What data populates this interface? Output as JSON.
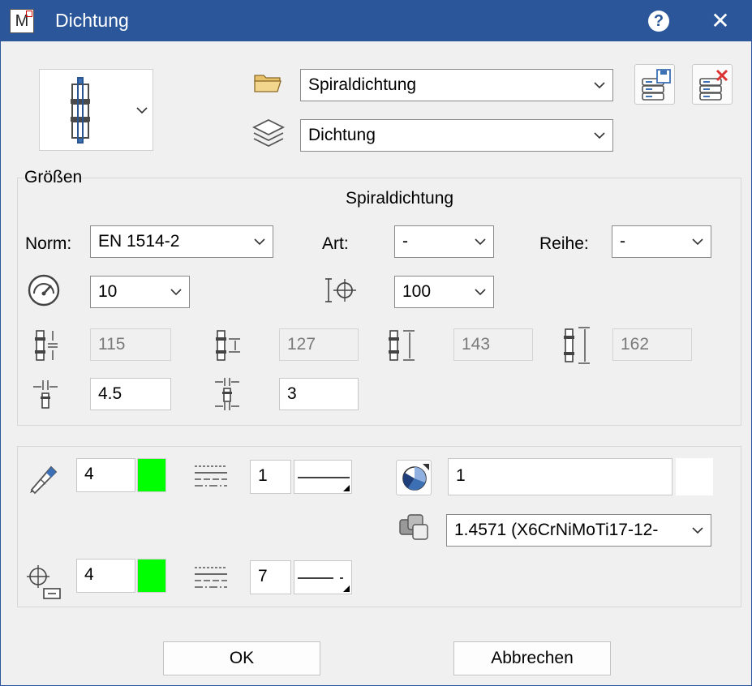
{
  "window": {
    "title": "Dichtung",
    "app_icon_letter": "M",
    "help_label": "?",
    "close_label": "✕"
  },
  "top": {
    "catalog_select": "Spiraldichtung",
    "layer_select": "Dichtung"
  },
  "sizes": {
    "group_title": "Größen",
    "heading": "Spiraldichtung",
    "norm_label": "Norm:",
    "norm_value": "EN 1514-2",
    "art_label": "Art:",
    "art_value": "-",
    "reihe_label": "Reihe:",
    "reihe_value": "-",
    "pressure_value": "10",
    "nominal_value": "100",
    "dim1": "115",
    "dim2": "127",
    "dim3": "143",
    "dim4": "162",
    "thickness1": "4.5",
    "thickness2": "3"
  },
  "attributes": {
    "pen_value": "4",
    "pen_color": "#00ff00",
    "line_style_value": "1",
    "fill_value": "1",
    "material_value": "1.4571 (X6CrNiMoTi17-12-",
    "axis_pen_value": "4",
    "axis_pen_color": "#00ff00",
    "axis_line_style_value": "7"
  },
  "buttons": {
    "ok": "OK",
    "cancel": "Abbrechen"
  },
  "icons": [
    "folder-icon",
    "layers-icon",
    "save-database-icon",
    "delete-database-icon",
    "pressure-gauge-icon",
    "nominal-diameter-icon",
    "pen-icon",
    "line-style-icon",
    "fill-pattern-icon",
    "material-icon",
    "axis-icon"
  ]
}
